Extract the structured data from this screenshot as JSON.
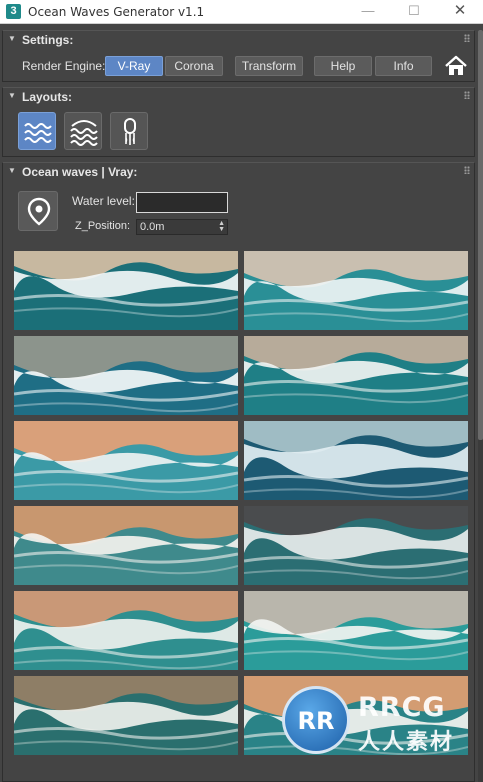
{
  "window": {
    "app_icon": "3",
    "title": "Ocean Waves Generator v1.1",
    "minimize_glyph": "—",
    "maximize_glyph": "☐",
    "close_glyph": "✕"
  },
  "settings": {
    "title": "Settings:",
    "render_engine_label": "Render Engine:",
    "buttons": [
      "V-Ray",
      "Corona",
      "Transform",
      "Help",
      "Info"
    ],
    "active_button": "V-Ray",
    "home_icon": "home-icon"
  },
  "layouts": {
    "title": "Layouts:",
    "icons": [
      "waves-flat-icon",
      "waves-layered-icon",
      "buoy-icon"
    ],
    "active_index": 0
  },
  "ocean": {
    "title": "Ocean waves | Vray:",
    "pin_icon": "location-pin-icon",
    "water_level_label": "Water level:",
    "water_level_value": "",
    "z_position_label": "Z_Position:",
    "z_position_value": "0.0m",
    "thumbnails": [
      {
        "sand": "#c7b8a0",
        "water": "#1b6f78",
        "foam": "#f2f6f7"
      },
      {
        "sand": "#c9bfb0",
        "water": "#2a8f96",
        "foam": "#eef4f4"
      },
      {
        "sand": "#8c948c",
        "water": "#1f6e85",
        "foam": "#f4f7f8"
      },
      {
        "sand": "#b7ab9a",
        "water": "#1f7f86",
        "foam": "#f0f3f2"
      },
      {
        "sand": "#d9a07a",
        "water": "#3b9aa6",
        "foam": "#eef2f2"
      },
      {
        "sand": "#9fbcc4",
        "water": "#1d5a73",
        "foam": "#e2eef2"
      },
      {
        "sand": "#c8976f",
        "water": "#3f8a8c",
        "foam": "#f3f2ee"
      },
      {
        "sand": "#4a4c4e",
        "water": "#2b6e73",
        "foam": "#e8eceb"
      },
      {
        "sand": "#c99877",
        "water": "#2f8f8f",
        "foam": "#eef1ee"
      },
      {
        "sand": "#b9b6ac",
        "water": "#2b9c9a",
        "foam": "#f1f4f1"
      },
      {
        "sand": "#8e7e66",
        "water": "#2a6f6e",
        "foam": "#eef0ec"
      },
      {
        "sand": "#d39c72",
        "water": "#2a8387",
        "foam": "#f3f3ef"
      }
    ]
  },
  "watermark": {
    "logo": "RR",
    "name": "RRCG",
    "sub": "人人素材"
  }
}
